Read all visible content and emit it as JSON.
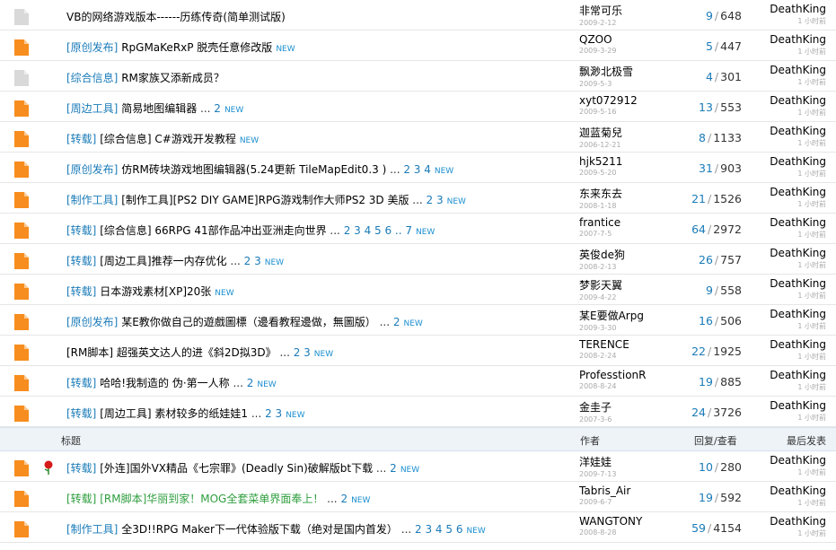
{
  "rows_top": [
    {
      "icon": "gray",
      "prefix": "",
      "title": "VB的网络游戏版本------历练传奇(简单测试版)",
      "pages": "",
      "new": false,
      "author": "非常可乐",
      "date": "2009-2-12",
      "replies": "9",
      "views": "648",
      "last": "DeathKing",
      "last_time": "1 小时前"
    },
    {
      "icon": "orange",
      "prefix": "[原创发布]",
      "title": "RpGMaKeRxP 脱壳任意修改版",
      "pages": "",
      "new": true,
      "author": "QZOO",
      "date": "2009-3-29",
      "replies": "5",
      "views": "447",
      "last": "DeathKing",
      "last_time": "1 小时前"
    },
    {
      "icon": "gray",
      "prefix": "[综合信息]",
      "title": "RM家族又添新成员？",
      "pages": "",
      "new": false,
      "author": "飘渺北极雪",
      "date": "2009-5-3",
      "replies": "4",
      "views": "301",
      "last": "DeathKing",
      "last_time": "1 小时前"
    },
    {
      "icon": "orange",
      "prefix": "[周边工具]",
      "title": "简易地图编辑器",
      "pages": "2",
      "new": true,
      "author": "xyt072912",
      "date": "2009-5-16",
      "replies": "13",
      "views": "553",
      "last": "DeathKing",
      "last_time": "1 小时前"
    },
    {
      "icon": "orange",
      "prefix": "[转载]",
      "title": "[综合信息] C#游戏开发教程",
      "pages": "",
      "new": true,
      "author": "迦蓝菊兒",
      "date": "2006-12-21",
      "replies": "8",
      "views": "1133",
      "last": "DeathKing",
      "last_time": "1 小时前"
    },
    {
      "icon": "orange",
      "prefix": "[原创发布]",
      "title": "仿RM砖块游戏地图编辑器(5.24更新 TileMapEdit0.3 )",
      "pages": "2 3 4",
      "new": true,
      "author": "hjk5211",
      "date": "2009-5-20",
      "replies": "31",
      "views": "903",
      "last": "DeathKing",
      "last_time": "1 小时前"
    },
    {
      "icon": "orange",
      "prefix": "[制作工具]",
      "title": "[制作工具][PS2 DIY GAME]RPG游戏制作大师PS2 3D 美版",
      "pages": "2 3",
      "new": true,
      "author": "东来东去",
      "date": "2008-1-18",
      "replies": "21",
      "views": "1526",
      "last": "DeathKing",
      "last_time": "1 小时前"
    },
    {
      "icon": "orange",
      "prefix": "[转载]",
      "title": "[综合信息] 66RPG 41部作品冲出亚洲走向世界",
      "pages": "2 3 4 5 6 .. 7",
      "new": true,
      "author": "frantice",
      "date": "2007-7-5",
      "replies": "64",
      "views": "2972",
      "last": "DeathKing",
      "last_time": "1 小时前"
    },
    {
      "icon": "orange",
      "prefix": "[转载]",
      "title": "[周边工具]推荐一内存优化",
      "pages": "2 3",
      "new": true,
      "author": "英俊de狗",
      "date": "2008-2-13",
      "replies": "26",
      "views": "757",
      "last": "DeathKing",
      "last_time": "1 小时前"
    },
    {
      "icon": "orange",
      "prefix": "[转载]",
      "title": "日本游戏素材[XP]20张",
      "pages": "",
      "new": true,
      "author": "梦影天翼",
      "date": "2009-4-22",
      "replies": "9",
      "views": "558",
      "last": "DeathKing",
      "last_time": "1 小时前"
    },
    {
      "icon": "orange",
      "prefix": "[原创发布]",
      "title": "某E教你做自己的遊戲圖標（邊看教程邊做，無圖版）",
      "pages": "2",
      "new": true,
      "author": "某E要做Arpg",
      "date": "2009-3-30",
      "replies": "16",
      "views": "506",
      "last": "DeathKing",
      "last_time": "1 小时前"
    },
    {
      "icon": "orange",
      "prefix": "",
      "title": "[RM脚本] 超强英文达人的进《斜2D拟3D》",
      "pages": "2 3",
      "new": true,
      "author": "TERENCE",
      "date": "2008-2-24",
      "replies": "22",
      "views": "1925",
      "last": "DeathKing",
      "last_time": "1 小时前"
    },
    {
      "icon": "orange",
      "prefix": "[转载]",
      "title": "哈哈!我制造的 伪·第一人称",
      "pages": "2",
      "new": true,
      "author": "ProfesstionR",
      "date": "2008-8-24",
      "replies": "19",
      "views": "885",
      "last": "DeathKing",
      "last_time": "1 小时前"
    },
    {
      "icon": "orange",
      "prefix": "[转载]",
      "title": "[周边工具] 素材较多的纸娃娃1",
      "pages": "2 3",
      "new": true,
      "author": "金圭子",
      "date": "2007-3-6",
      "replies": "24",
      "views": "3726",
      "last": "DeathKing",
      "last_time": "1 小时前"
    }
  ],
  "header": {
    "title": "标题",
    "author": "作者",
    "counts": "回复/查看",
    "last": "最后发表"
  },
  "rows_bottom": [
    {
      "icon": "orange",
      "flower": true,
      "prefix": "[转载]",
      "title": "[外连]国外VX精品《七宗罪》(Deadly Sin)破解版bt下载",
      "pages": "2",
      "new": true,
      "author": "洋娃娃",
      "date": "2009-7-13",
      "replies": "10",
      "views": "280",
      "last": "DeathKing",
      "last_time": "1 小时前",
      "prefix_green": false
    },
    {
      "icon": "orange",
      "flower": false,
      "prefix": "[转载]",
      "title": "[RM脚本]华丽到家！MOG全套菜单界面奉上！",
      "pages": "2",
      "new": true,
      "author": "Tabris_Air",
      "date": "2009-6-7",
      "replies": "19",
      "views": "592",
      "last": "DeathKing",
      "last_time": "1 小时前",
      "prefix_green": true
    },
    {
      "icon": "orange",
      "flower": false,
      "prefix": "[制作工具]",
      "title": "全3D!!RPG Maker下一代体验版下载（绝对是国内首发）",
      "pages": "2 3 4 5 6",
      "new": true,
      "author": "WANGTONY",
      "date": "2008-8-28",
      "replies": "59",
      "views": "4154",
      "last": "DeathKing",
      "last_time": "1 小时前",
      "prefix_green": false
    }
  ],
  "labels": {
    "new": "NEW",
    "ellipsis": "..."
  },
  "colors": {
    "folder_orange": "#f78d1e",
    "folder_gray": "#d9d9d9",
    "link_blue": "#1a7bb8",
    "header_bg": "#eef3f7"
  }
}
